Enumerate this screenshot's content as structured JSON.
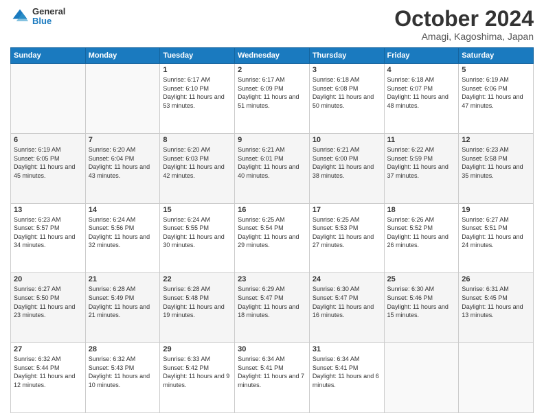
{
  "logo": {
    "general": "General",
    "blue": "Blue"
  },
  "title": "October 2024",
  "subtitle": "Amagi, Kagoshima, Japan",
  "header_days": [
    "Sunday",
    "Monday",
    "Tuesday",
    "Wednesday",
    "Thursday",
    "Friday",
    "Saturday"
  ],
  "weeks": [
    [
      {
        "day": "",
        "sunrise": "",
        "sunset": "",
        "daylight": ""
      },
      {
        "day": "",
        "sunrise": "",
        "sunset": "",
        "daylight": ""
      },
      {
        "day": "1",
        "sunrise": "Sunrise: 6:17 AM",
        "sunset": "Sunset: 6:10 PM",
        "daylight": "Daylight: 11 hours and 53 minutes."
      },
      {
        "day": "2",
        "sunrise": "Sunrise: 6:17 AM",
        "sunset": "Sunset: 6:09 PM",
        "daylight": "Daylight: 11 hours and 51 minutes."
      },
      {
        "day": "3",
        "sunrise": "Sunrise: 6:18 AM",
        "sunset": "Sunset: 6:08 PM",
        "daylight": "Daylight: 11 hours and 50 minutes."
      },
      {
        "day": "4",
        "sunrise": "Sunrise: 6:18 AM",
        "sunset": "Sunset: 6:07 PM",
        "daylight": "Daylight: 11 hours and 48 minutes."
      },
      {
        "day": "5",
        "sunrise": "Sunrise: 6:19 AM",
        "sunset": "Sunset: 6:06 PM",
        "daylight": "Daylight: 11 hours and 47 minutes."
      }
    ],
    [
      {
        "day": "6",
        "sunrise": "Sunrise: 6:19 AM",
        "sunset": "Sunset: 6:05 PM",
        "daylight": "Daylight: 11 hours and 45 minutes."
      },
      {
        "day": "7",
        "sunrise": "Sunrise: 6:20 AM",
        "sunset": "Sunset: 6:04 PM",
        "daylight": "Daylight: 11 hours and 43 minutes."
      },
      {
        "day": "8",
        "sunrise": "Sunrise: 6:20 AM",
        "sunset": "Sunset: 6:03 PM",
        "daylight": "Daylight: 11 hours and 42 minutes."
      },
      {
        "day": "9",
        "sunrise": "Sunrise: 6:21 AM",
        "sunset": "Sunset: 6:01 PM",
        "daylight": "Daylight: 11 hours and 40 minutes."
      },
      {
        "day": "10",
        "sunrise": "Sunrise: 6:21 AM",
        "sunset": "Sunset: 6:00 PM",
        "daylight": "Daylight: 11 hours and 38 minutes."
      },
      {
        "day": "11",
        "sunrise": "Sunrise: 6:22 AM",
        "sunset": "Sunset: 5:59 PM",
        "daylight": "Daylight: 11 hours and 37 minutes."
      },
      {
        "day": "12",
        "sunrise": "Sunrise: 6:23 AM",
        "sunset": "Sunset: 5:58 PM",
        "daylight": "Daylight: 11 hours and 35 minutes."
      }
    ],
    [
      {
        "day": "13",
        "sunrise": "Sunrise: 6:23 AM",
        "sunset": "Sunset: 5:57 PM",
        "daylight": "Daylight: 11 hours and 34 minutes."
      },
      {
        "day": "14",
        "sunrise": "Sunrise: 6:24 AM",
        "sunset": "Sunset: 5:56 PM",
        "daylight": "Daylight: 11 hours and 32 minutes."
      },
      {
        "day": "15",
        "sunrise": "Sunrise: 6:24 AM",
        "sunset": "Sunset: 5:55 PM",
        "daylight": "Daylight: 11 hours and 30 minutes."
      },
      {
        "day": "16",
        "sunrise": "Sunrise: 6:25 AM",
        "sunset": "Sunset: 5:54 PM",
        "daylight": "Daylight: 11 hours and 29 minutes."
      },
      {
        "day": "17",
        "sunrise": "Sunrise: 6:25 AM",
        "sunset": "Sunset: 5:53 PM",
        "daylight": "Daylight: 11 hours and 27 minutes."
      },
      {
        "day": "18",
        "sunrise": "Sunrise: 6:26 AM",
        "sunset": "Sunset: 5:52 PM",
        "daylight": "Daylight: 11 hours and 26 minutes."
      },
      {
        "day": "19",
        "sunrise": "Sunrise: 6:27 AM",
        "sunset": "Sunset: 5:51 PM",
        "daylight": "Daylight: 11 hours and 24 minutes."
      }
    ],
    [
      {
        "day": "20",
        "sunrise": "Sunrise: 6:27 AM",
        "sunset": "Sunset: 5:50 PM",
        "daylight": "Daylight: 11 hours and 23 minutes."
      },
      {
        "day": "21",
        "sunrise": "Sunrise: 6:28 AM",
        "sunset": "Sunset: 5:49 PM",
        "daylight": "Daylight: 11 hours and 21 minutes."
      },
      {
        "day": "22",
        "sunrise": "Sunrise: 6:28 AM",
        "sunset": "Sunset: 5:48 PM",
        "daylight": "Daylight: 11 hours and 19 minutes."
      },
      {
        "day": "23",
        "sunrise": "Sunrise: 6:29 AM",
        "sunset": "Sunset: 5:47 PM",
        "daylight": "Daylight: 11 hours and 18 minutes."
      },
      {
        "day": "24",
        "sunrise": "Sunrise: 6:30 AM",
        "sunset": "Sunset: 5:47 PM",
        "daylight": "Daylight: 11 hours and 16 minutes."
      },
      {
        "day": "25",
        "sunrise": "Sunrise: 6:30 AM",
        "sunset": "Sunset: 5:46 PM",
        "daylight": "Daylight: 11 hours and 15 minutes."
      },
      {
        "day": "26",
        "sunrise": "Sunrise: 6:31 AM",
        "sunset": "Sunset: 5:45 PM",
        "daylight": "Daylight: 11 hours and 13 minutes."
      }
    ],
    [
      {
        "day": "27",
        "sunrise": "Sunrise: 6:32 AM",
        "sunset": "Sunset: 5:44 PM",
        "daylight": "Daylight: 11 hours and 12 minutes."
      },
      {
        "day": "28",
        "sunrise": "Sunrise: 6:32 AM",
        "sunset": "Sunset: 5:43 PM",
        "daylight": "Daylight: 11 hours and 10 minutes."
      },
      {
        "day": "29",
        "sunrise": "Sunrise: 6:33 AM",
        "sunset": "Sunset: 5:42 PM",
        "daylight": "Daylight: 11 hours and 9 minutes."
      },
      {
        "day": "30",
        "sunrise": "Sunrise: 6:34 AM",
        "sunset": "Sunset: 5:41 PM",
        "daylight": "Daylight: 11 hours and 7 minutes."
      },
      {
        "day": "31",
        "sunrise": "Sunrise: 6:34 AM",
        "sunset": "Sunset: 5:41 PM",
        "daylight": "Daylight: 11 hours and 6 minutes."
      },
      {
        "day": "",
        "sunrise": "",
        "sunset": "",
        "daylight": ""
      },
      {
        "day": "",
        "sunrise": "",
        "sunset": "",
        "daylight": ""
      }
    ]
  ]
}
